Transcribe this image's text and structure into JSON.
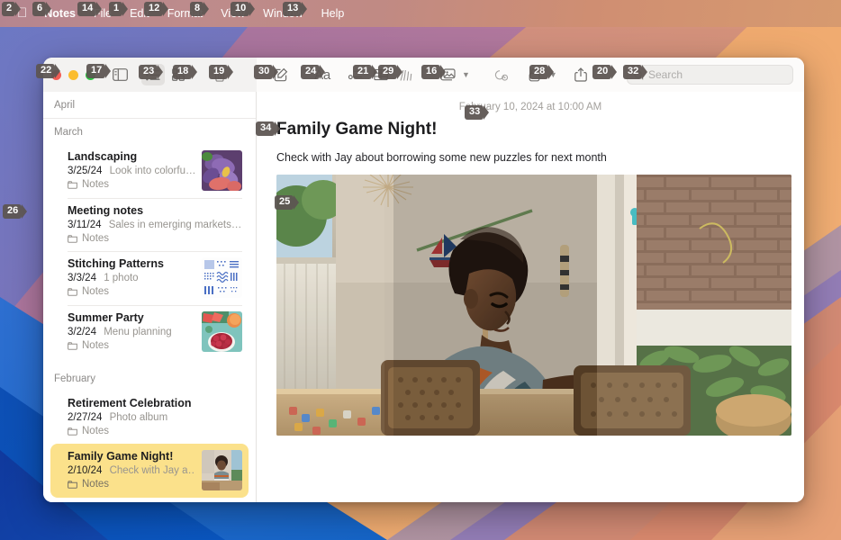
{
  "menubar": {
    "items": [
      {
        "label": "",
        "name": "apple-menu",
        "badge": "2",
        "bold": false,
        "logo": true
      },
      {
        "label": "Notes",
        "name": "menu-notes",
        "badge": "6",
        "bold": true
      },
      {
        "label": "File",
        "name": "menu-file",
        "badge": "14",
        "bold": false
      },
      {
        "label": "Edit",
        "name": "menu-edit",
        "badge": "1",
        "bold": false
      },
      {
        "label": "Format",
        "name": "menu-format",
        "badge": "12",
        "bold": false
      },
      {
        "label": "View",
        "name": "menu-view",
        "badge": "8",
        "bold": false
      },
      {
        "label": "Window",
        "name": "menu-window",
        "badge": "10",
        "bold": false
      },
      {
        "label": "Help",
        "name": "menu-help",
        "badge": "13",
        "bold": false
      }
    ]
  },
  "desktop": {
    "badge_26": "26"
  },
  "window": {
    "traffic_lights": {
      "close_badge": "22",
      "close_color": "#f25d55",
      "minimize_color": "#fbbd2e",
      "zoom_color": "#2bc940",
      "zoom_badge": "17"
    },
    "toolbar": {
      "sidebar_toggle": {
        "name": "sidebar-toggle-button",
        "badge": ""
      },
      "list_view": {
        "name": "list-view-button",
        "badge": "23",
        "active": true
      },
      "gallery_view": {
        "name": "gallery-view-button",
        "badge": "18",
        "active": false
      },
      "delete": {
        "name": "delete-note-button",
        "badge": "19"
      },
      "compose": {
        "name": "new-note-button",
        "badge": "30"
      },
      "format": {
        "name": "format-button",
        "label": "Aa",
        "badge": "24"
      },
      "checklist": {
        "name": "checklist-button",
        "badge": "21"
      },
      "table": {
        "name": "table-button",
        "badge": "29"
      },
      "markup": {
        "name": "markup-button",
        "badge": "16"
      },
      "media": {
        "name": "media-button",
        "badge": ""
      },
      "collaborate": {
        "name": "collaborate-button",
        "badge": "28"
      },
      "lock": {
        "name": "lock-note-button",
        "badge": ""
      },
      "share": {
        "name": "share-button",
        "badge": "20"
      },
      "search": {
        "name": "search-field",
        "badge": "32",
        "placeholder": "Search",
        "value": ""
      }
    }
  },
  "sidebar": {
    "sections": [
      {
        "month": "April",
        "name": "section-april",
        "notes": []
      },
      {
        "month": "March",
        "name": "section-march",
        "notes": [
          {
            "title": "Landscaping",
            "date": "3/25/24",
            "snippet": "Look into colorfu…",
            "folder": "Notes",
            "thumb": "iris",
            "selected": false
          },
          {
            "title": "Meeting notes",
            "date": "3/11/24",
            "snippet": "Sales in emerging markets…",
            "folder": "Notes",
            "thumb": "none",
            "selected": false
          },
          {
            "title": "Stitching Patterns",
            "date": "3/3/24",
            "snippet": "1 photo",
            "folder": "Notes",
            "thumb": "stitch",
            "selected": false
          },
          {
            "title": "Summer Party",
            "date": "3/2/24",
            "snippet": "Menu planning",
            "folder": "Notes",
            "thumb": "food",
            "selected": false
          }
        ]
      },
      {
        "month": "February",
        "name": "section-february",
        "notes": [
          {
            "title": "Retirement Celebration",
            "date": "2/27/24",
            "snippet": "Photo album",
            "folder": "Notes",
            "thumb": "none",
            "selected": false
          },
          {
            "title": "Family Game Night!",
            "date": "2/10/24",
            "snippet": "Check with Jay a…",
            "folder": "Notes",
            "thumb": "boy",
            "selected": true
          }
        ]
      }
    ]
  },
  "note": {
    "date": "February 10, 2024 at 10:00 AM",
    "date_badge": "33",
    "title": "Family Game Night!",
    "title_badge": "34",
    "body": "Check with Jay about borrowing some new puzzles for next month",
    "photo_badge": "25",
    "photo_alt": "boy-at-table-photo"
  },
  "colors": {
    "selection_yellow": "#fbe18b",
    "toolbar_left": "#f3f2f1",
    "toolbar_right": "#fcfbfa",
    "badge_bg": "#5c5552"
  }
}
